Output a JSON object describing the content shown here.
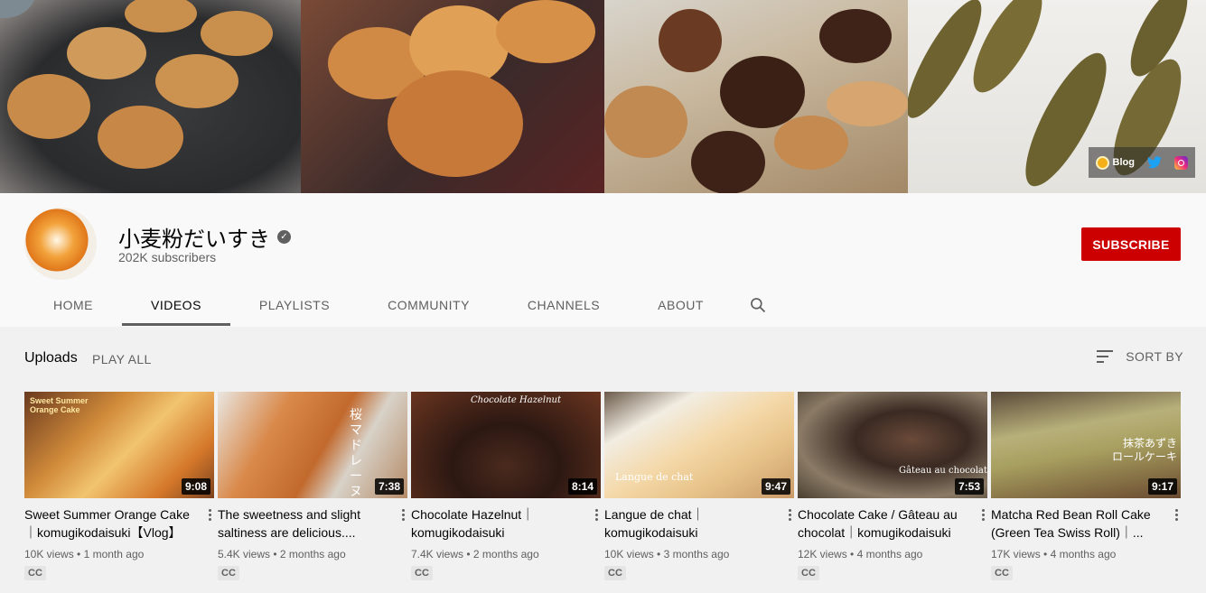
{
  "banner": {
    "links": {
      "blog_label": "Blog"
    }
  },
  "channel": {
    "name": "小麦粉だいすき",
    "subscribers": "202K subscribers",
    "subscribe_label": "SUBSCRIBE"
  },
  "tabs": [
    {
      "label": "HOME"
    },
    {
      "label": "VIDEOS"
    },
    {
      "label": "PLAYLISTS"
    },
    {
      "label": "COMMUNITY"
    },
    {
      "label": "CHANNELS"
    },
    {
      "label": "ABOUT"
    }
  ],
  "uploads": {
    "title": "Uploads",
    "play_all": "PLAY ALL",
    "sort_by": "SORT BY"
  },
  "videos": [
    {
      "title": "Sweet Summer Orange Cake｜komugikodaisuki【Vlog】",
      "duration": "9:08",
      "views": "10K views",
      "age": "1 month ago",
      "badge": "CC",
      "thumb_text": "Sweet Summer Orange Cake"
    },
    {
      "title": "The sweetness and slight saltiness are delicious....",
      "duration": "7:38",
      "views": "5.4K views",
      "age": "2 months ago",
      "badge": "CC",
      "thumb_text": "桜 マドレーヌ"
    },
    {
      "title": "Chocolate Hazelnut｜komugikodaisuki",
      "duration": "8:14",
      "views": "7.4K views",
      "age": "2 months ago",
      "badge": "CC",
      "thumb_text": "Chocolate Hazelnut"
    },
    {
      "title": "Langue de chat｜komugikodaisuki",
      "duration": "9:47",
      "views": "10K views",
      "age": "3 months ago",
      "badge": "CC",
      "thumb_text": "Langue de chat"
    },
    {
      "title": "Chocolate Cake / Gâteau au chocolat｜komugikodaisuki",
      "duration": "7:53",
      "views": "12K views",
      "age": "4 months ago",
      "badge": "CC",
      "thumb_text": "Gâteau au chocolat"
    },
    {
      "title": "Matcha Red Bean Roll Cake (Green Tea Swiss Roll)｜...",
      "duration": "9:17",
      "views": "17K views",
      "age": "4 months ago",
      "badge": "CC",
      "thumb_text": "抹茶あずき ロールケーキ"
    }
  ]
}
